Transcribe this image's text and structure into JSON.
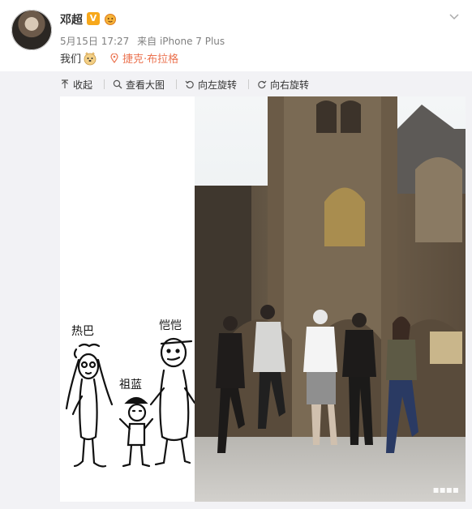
{
  "post": {
    "username": "邓超",
    "verified_badge": "V",
    "date": "5月15日 17:27",
    "source": "来自 iPhone 7 Plus",
    "text": "我们",
    "location": "捷克·布拉格"
  },
  "toolbar": {
    "collapse": "收起",
    "view_large": "查看大图",
    "rotate_left": "向左旋转",
    "rotate_right": "向右旋转"
  },
  "sketch": {
    "label_1": "热巴",
    "label_2": "祖蓝",
    "label_3": "恺恺"
  },
  "icons": {
    "badge": "vip-badge-icon",
    "emoji": "dog-emoji-icon",
    "location": "location-pin-icon",
    "menu": "chevron-down-icon"
  },
  "colors": {
    "location": "#eb7350",
    "verified": "#f7a81b",
    "toolbar_bg": "#f2f2f5"
  }
}
